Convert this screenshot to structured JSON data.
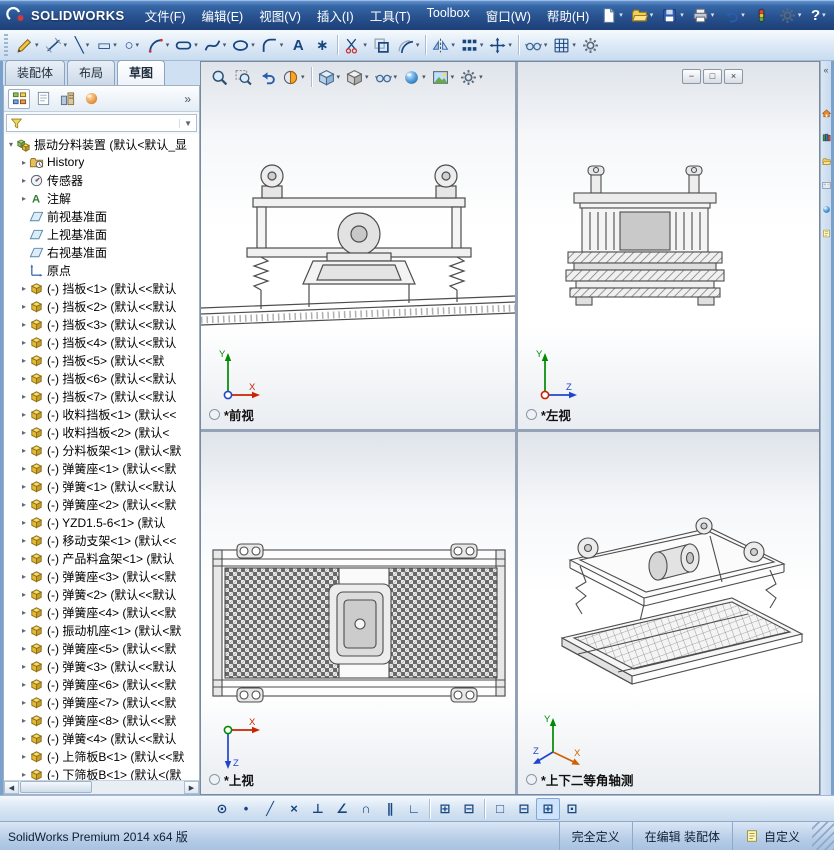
{
  "ui": {
    "caret": "▾",
    "expand": "▸",
    "root_expand": "▾",
    "filter_caret": "▼",
    "scroll_left": "◀",
    "scroll_right": "▶"
  },
  "colors": {
    "titlebar": "#28528f",
    "toolbar": "#d8e6f5",
    "accent": "#17467f",
    "status_bar": "#b7cde7",
    "splitter": "#93a3b5"
  },
  "titlebar": {
    "logo_text": "SOLIDWORKS",
    "menus": [
      {
        "label": "文件(F)",
        "name": "menu-file"
      },
      {
        "label": "编辑(E)",
        "name": "menu-edit"
      },
      {
        "label": "视图(V)",
        "name": "menu-view"
      },
      {
        "label": "插入(I)",
        "name": "menu-insert"
      },
      {
        "label": "工具(T)",
        "name": "menu-tools"
      },
      {
        "label": "Toolbox",
        "name": "menu-toolbox"
      },
      {
        "label": "窗口(W)",
        "name": "menu-window"
      },
      {
        "label": "帮助(H)",
        "name": "menu-help"
      }
    ],
    "quick_icons": [
      {
        "name": "new-document-button",
        "icon": "page",
        "dropdown": true
      },
      {
        "name": "open-document-button",
        "icon": "folder",
        "dropdown": true
      },
      {
        "name": "save-button",
        "icon": "floppy",
        "dropdown": true
      },
      {
        "name": "print-button",
        "icon": "printer",
        "dropdown": true
      },
      {
        "name": "undo-button",
        "icon": "undo",
        "dropdown": true
      },
      {
        "name": "rebuild-button",
        "icon": "rebuild"
      },
      {
        "name": "options-button",
        "icon": "gear",
        "dropdown": true
      },
      {
        "name": "help-button",
        "glyph": "?",
        "color": "#ffffff",
        "dropdown": true
      }
    ]
  },
  "toolbar": {
    "items": [
      {
        "name": "sketch-button",
        "icon": "pencil",
        "dropdown": true
      },
      {
        "name": "smart-dimension-button",
        "icon": "dimension",
        "dropdown": true
      },
      {
        "name": "line-tool-button",
        "glyph": "╲",
        "dropdown": true
      },
      {
        "name": "rectangle-tool-button",
        "glyph": "▭",
        "dropdown": true
      },
      {
        "name": "circle-tool-button",
        "glyph": "○",
        "dropdown": true
      },
      {
        "name": "arc-tool-button",
        "icon": "arc",
        "dropdown": true
      },
      {
        "name": "slot-tool-button",
        "icon": "slot",
        "dropdown": true
      },
      {
        "name": "spline-tool-button",
        "icon": "spline",
        "dropdown": true
      },
      {
        "name": "ellipse-tool-button",
        "icon": "ellipse",
        "dropdown": true
      },
      {
        "name": "sketch-fillet-button",
        "icon": "fillet",
        "dropdown": true
      },
      {
        "name": "text-tool-button",
        "glyph": "A"
      },
      {
        "name": "point-tool-button",
        "glyph": "∗"
      },
      {
        "sep": true
      },
      {
        "name": "trim-entities-button",
        "icon": "trim",
        "dropdown": true
      },
      {
        "name": "convert-entities-button",
        "icon": "convert"
      },
      {
        "name": "offset-entities-button",
        "icon": "offset",
        "dropdown": true
      },
      {
        "sep": true
      },
      {
        "name": "mirror-entities-button",
        "icon": "mirror",
        "dropdown": true
      },
      {
        "name": "linear-pattern-button",
        "icon": "pattern",
        "dropdown": true
      },
      {
        "name": "move-entities-button",
        "icon": "move",
        "dropdown": true
      },
      {
        "sep": true
      },
      {
        "name": "display-relations-button",
        "icon": "glasses",
        "dropdown": true
      },
      {
        "name": "grid-settings-button",
        "icon": "grid",
        "dropdown": true
      },
      {
        "name": "sketch-settings-button",
        "icon": "gear"
      }
    ]
  },
  "tabs": {
    "items": [
      {
        "label": "装配体",
        "name": "tab-assembly"
      },
      {
        "label": "布局",
        "name": "tab-layout"
      },
      {
        "label": "草图",
        "name": "tab-sketch",
        "active": true
      }
    ]
  },
  "feature_panel": {
    "header_icons": [
      {
        "name": "featuremanager-tab",
        "icon": "fmtree",
        "active": true
      },
      {
        "name": "propertymanager-tab",
        "icon": "fmprop"
      },
      {
        "name": "configurationmanager-tab",
        "icon": "fmconfig"
      },
      {
        "name": "displaymanager-tab",
        "icon": "fmdisplay"
      }
    ],
    "overflow_glyph": "»",
    "tree": {
      "root_label": "振动分料装置 (默认<默认_显",
      "items": [
        {
          "icon": "history",
          "label": "History",
          "expand": true,
          "name": "tree-item-history"
        },
        {
          "icon": "sensor",
          "label": "传感器",
          "expand": true,
          "name": "tree-item-sensors"
        },
        {
          "icon": "annotation",
          "label": "注解",
          "expand": true,
          "name": "tree-item-annotations"
        },
        {
          "icon": "plane",
          "label": "前视基准面",
          "name": "tree-item-front-plane"
        },
        {
          "icon": "plane",
          "label": "上视基准面",
          "name": "tree-item-top-plane"
        },
        {
          "icon": "plane",
          "label": "右视基准面",
          "name": "tree-item-right-plane"
        },
        {
          "icon": "origin",
          "label": "原点",
          "name": "tree-item-origin"
        },
        {
          "icon": "part",
          "label": "(-) 挡板<1> (默认<<默认",
          "expand": true
        },
        {
          "icon": "part",
          "label": "(-) 挡板<2> (默认<<默认",
          "expand": true
        },
        {
          "icon": "part",
          "label": "(-) 挡板<3> (默认<<默认",
          "expand": true
        },
        {
          "icon": "part",
          "label": "(-) 挡板<4> (默认<<默认",
          "expand": true
        },
        {
          "icon": "part",
          "label": "(-) 挡板<5> (默认<<默",
          "expand": true
        },
        {
          "icon": "part",
          "label": "(-) 挡板<6> (默认<<默认",
          "expand": true
        },
        {
          "icon": "part",
          "label": "(-) 挡板<7> (默认<<默认",
          "expand": true
        },
        {
          "icon": "part",
          "label": "(-) 收料挡板<1> (默认<<",
          "expand": true
        },
        {
          "icon": "part",
          "label": "(-) 收料挡板<2> (默认<",
          "expand": true
        },
        {
          "icon": "part",
          "label": "(-) 分料板架<1> (默认<默",
          "expand": true
        },
        {
          "icon": "part",
          "label": "(-) 弹簧座<1> (默认<<默",
          "expand": true
        },
        {
          "icon": "part",
          "label": "(-) 弹簧<1> (默认<<默认",
          "expand": true
        },
        {
          "icon": "part",
          "label": "(-) 弹簧座<2> (默认<<默",
          "expand": true
        },
        {
          "icon": "part",
          "label": "(-) YZD1.5-6<1> (默认",
          "expand": true
        },
        {
          "icon": "part",
          "label": "(-) 移动支架<1> (默认<<",
          "expand": true
        },
        {
          "icon": "part",
          "label": "(-) 产品料盒架<1> (默认",
          "expand": true
        },
        {
          "icon": "part",
          "label": "(-) 弹簧座<3> (默认<<默",
          "expand": true
        },
        {
          "icon": "part",
          "label": "(-) 弹簧<2> (默认<<默认",
          "expand": true
        },
        {
          "icon": "part",
          "label": "(-) 弹簧座<4> (默认<<默",
          "expand": true
        },
        {
          "icon": "part",
          "label": "(-) 振动机座<1> (默认<默",
          "expand": true
        },
        {
          "icon": "part",
          "label": "(-) 弹簧座<5> (默认<<默",
          "expand": true
        },
        {
          "icon": "part",
          "label": "(-) 弹簧<3> (默认<<默认",
          "expand": true
        },
        {
          "icon": "part",
          "label": "(-) 弹簧座<6> (默认<<默",
          "expand": true
        },
        {
          "icon": "part",
          "label": "(-) 弹簧座<7> (默认<<默",
          "expand": true
        },
        {
          "icon": "part",
          "label": "(-) 弹簧座<8> (默认<<默",
          "expand": true
        },
        {
          "icon": "part",
          "label": "(-) 弹簧<4> (默认<<默认",
          "expand": true
        },
        {
          "icon": "part",
          "label": "(-) 上筛板B<1> (默认<<默",
          "expand": true
        },
        {
          "icon": "part",
          "label": "(-) 下筛板B<1> (默认<(默",
          "expand": true
        }
      ]
    }
  },
  "viewport": {
    "headsup": [
      {
        "name": "zoom-fit-button",
        "icon": "magnifier"
      },
      {
        "name": "zoom-area-button",
        "icon": "magnifier-area"
      },
      {
        "name": "previous-view-button",
        "icon": "undo"
      },
      {
        "name": "section-view-button",
        "icon": "section",
        "dropdown": true
      },
      {
        "sep": true
      },
      {
        "name": "view-orientation-button",
        "icon": "cubeview",
        "dropdown": true
      },
      {
        "name": "display-style-button",
        "icon": "displaystyle",
        "dropdown": true
      },
      {
        "name": "hide-show-items-button",
        "icon": "glasses",
        "dropdown": true
      },
      {
        "name": "edit-appearance-button",
        "icon": "sphere",
        "dropdown": true
      },
      {
        "name": "apply-scene-button",
        "icon": "scene",
        "dropdown": true
      },
      {
        "name": "view-settings-button",
        "icon": "gear",
        "dropdown": true
      }
    ],
    "window_buttons": [
      {
        "name": "document-minimize-button",
        "glyph": "−"
      },
      {
        "name": "document-restore-button",
        "glyph": "□"
      },
      {
        "name": "document-close-button",
        "glyph": "×"
      }
    ],
    "panes": [
      {
        "label": "*前视",
        "axes": {
          "up": "Y",
          "right": "X"
        }
      },
      {
        "label": "*左视",
        "axes": {
          "up": "Y",
          "right": "Z"
        }
      },
      {
        "label": "*上视",
        "axes": {
          "right": "X",
          "down": "Z"
        }
      },
      {
        "label": "*上下二等角轴测",
        "axes": {
          "up": "Y",
          "se": "X",
          "sw": "Z"
        }
      }
    ]
  },
  "taskpane": {
    "collapse_glyph": "«",
    "items": [
      {
        "name": "taskpane-resources-button",
        "icon": "house"
      },
      {
        "name": "taskpane-design-library-button",
        "icon": "book"
      },
      {
        "name": "taskpane-file-explorer-button",
        "icon": "folder"
      },
      {
        "name": "taskpane-view-palette-button",
        "icon": "palette"
      },
      {
        "name": "taskpane-appearances-button",
        "icon": "sphere"
      },
      {
        "name": "taskpane-custom-properties-button",
        "icon": "note"
      }
    ]
  },
  "bottom_toolbar": {
    "items": [
      {
        "name": "snap-select-button",
        "glyph": "⊙"
      },
      {
        "name": "snap-point-button",
        "glyph": "•"
      },
      {
        "name": "snap-line-button",
        "glyph": "╱"
      },
      {
        "name": "snap-intersection-button",
        "glyph": "×"
      },
      {
        "name": "snap-perpendicular-button",
        "glyph": "⊥"
      },
      {
        "name": "snap-angle-button",
        "glyph": "∠"
      },
      {
        "name": "snap-tangent-button",
        "glyph": "∩"
      },
      {
        "name": "snap-parallel-button",
        "glyph": "∥"
      },
      {
        "name": "snap-hv-button",
        "glyph": "∟"
      },
      {
        "sep": true
      },
      {
        "name": "grid-snap-button",
        "glyph": "⊞"
      },
      {
        "name": "snap-length-button",
        "glyph": "⊟"
      },
      {
        "sep": true
      },
      {
        "name": "viewport-single-button",
        "glyph": "□"
      },
      {
        "name": "viewport-two-button",
        "glyph": "⊟"
      },
      {
        "name": "viewport-four-button",
        "glyph": "⊞",
        "active": true
      },
      {
        "name": "link-views-button",
        "glyph": "⊡"
      }
    ]
  },
  "statusbar": {
    "app_version": "SolidWorks Premium 2014 x64 版",
    "definition_status": "完全定义",
    "editing_status": "在编辑 装配体",
    "custom_label": "自定义"
  }
}
